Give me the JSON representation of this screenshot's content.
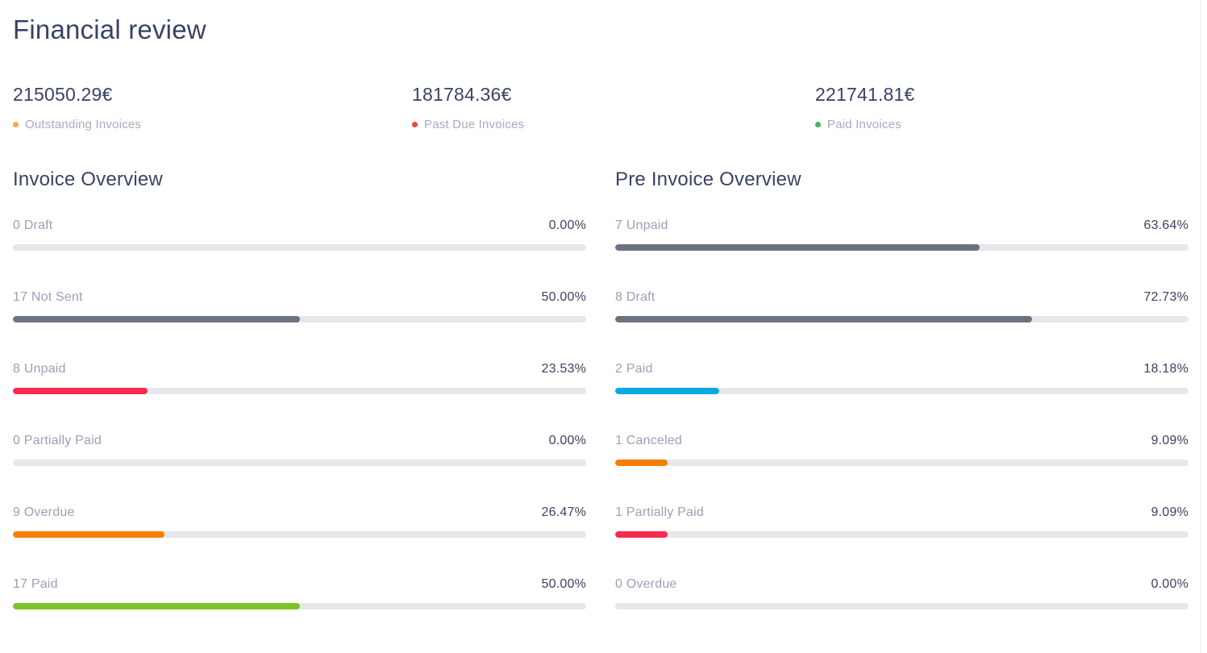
{
  "page": {
    "title": "Financial review"
  },
  "kpis": [
    {
      "value": "215050.29€",
      "label": "Outstanding Invoices",
      "dot_color": "#eeb12e"
    },
    {
      "value": "181784.36€",
      "label": "Past Due Invoices",
      "dot_color": "#e94d35"
    },
    {
      "value": "221741.81€",
      "label": "Paid Invoices",
      "dot_color": "#3fb85a"
    }
  ],
  "colors": {
    "track": "#e6e7eb",
    "gray": "#6b7380",
    "red": "#f82b4c",
    "orange": "#f87e00",
    "green": "#7cc327",
    "blue": "#0ca9e6"
  },
  "sections": [
    {
      "title": "Invoice Overview",
      "rows": [
        {
          "label": "0 Draft",
          "percent": "0.00%",
          "value": 0,
          "color": "#6b7380"
        },
        {
          "label": "17 Not Sent",
          "percent": "50.00%",
          "value": 50,
          "color": "#6b7380"
        },
        {
          "label": "8 Unpaid",
          "percent": "23.53%",
          "value": 23.53,
          "color": "#f82b4c"
        },
        {
          "label": "0 Partially Paid",
          "percent": "0.00%",
          "value": 0,
          "color": "#f82b4c"
        },
        {
          "label": "9 Overdue",
          "percent": "26.47%",
          "value": 26.47,
          "color": "#f87e00"
        },
        {
          "label": "17 Paid",
          "percent": "50.00%",
          "value": 50,
          "color": "#7cc327"
        }
      ]
    },
    {
      "title": "Pre Invoice Overview",
      "rows": [
        {
          "label": "7 Unpaid",
          "percent": "63.64%",
          "value": 63.64,
          "color": "#6b7380"
        },
        {
          "label": "8 Draft",
          "percent": "72.73%",
          "value": 72.73,
          "color": "#6b7380"
        },
        {
          "label": "2 Paid",
          "percent": "18.18%",
          "value": 18.18,
          "color": "#0ca9e6"
        },
        {
          "label": "1 Canceled",
          "percent": "9.09%",
          "value": 9.09,
          "color": "#f87e00"
        },
        {
          "label": "1 Partially Paid",
          "percent": "9.09%",
          "value": 9.09,
          "color": "#f82b4c"
        },
        {
          "label": "0 Overdue",
          "percent": "0.00%",
          "value": 0,
          "color": "#6b7380"
        }
      ]
    }
  ]
}
